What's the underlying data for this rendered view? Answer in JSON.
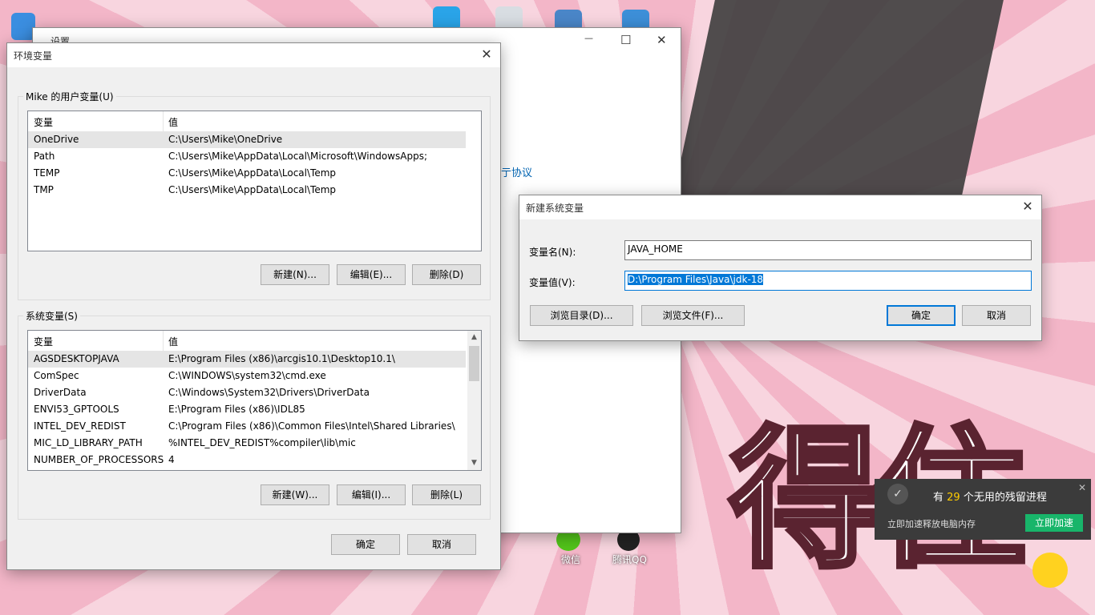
{
  "desktop": {
    "icons": [
      {
        "label": "微信"
      },
      {
        "label": "腾讯QQ"
      }
    ]
  },
  "settings_window": {
    "title": "设置",
    "link_fragment": "亍协议",
    "minimize": "—",
    "maximize": "☐",
    "close": "✕"
  },
  "env_dialog": {
    "title": "环境变量",
    "close": "✕",
    "user_group_label": "Mike 的用户变量(U)",
    "system_group_label": "系统变量(S)",
    "col_var": "变量",
    "col_value": "值",
    "user_vars": [
      {
        "name": "OneDrive",
        "value": "C:\\Users\\Mike\\OneDrive"
      },
      {
        "name": "Path",
        "value": "C:\\Users\\Mike\\AppData\\Local\\Microsoft\\WindowsApps;"
      },
      {
        "name": "TEMP",
        "value": "C:\\Users\\Mike\\AppData\\Local\\Temp"
      },
      {
        "name": "TMP",
        "value": "C:\\Users\\Mike\\AppData\\Local\\Temp"
      }
    ],
    "system_vars": [
      {
        "name": "AGSDESKTOPJAVA",
        "value": "E:\\Program Files (x86)\\arcgis10.1\\Desktop10.1\\"
      },
      {
        "name": "ComSpec",
        "value": "C:\\WINDOWS\\system32\\cmd.exe"
      },
      {
        "name": "DriverData",
        "value": "C:\\Windows\\System32\\Drivers\\DriverData"
      },
      {
        "name": "ENVI53_GPTOOLS",
        "value": "E:\\Program Files (x86)\\IDL85"
      },
      {
        "name": "INTEL_DEV_REDIST",
        "value": "C:\\Program Files (x86)\\Common Files\\Intel\\Shared Libraries\\"
      },
      {
        "name": "MIC_LD_LIBRARY_PATH",
        "value": "%INTEL_DEV_REDIST%compiler\\lib\\mic"
      },
      {
        "name": "NUMBER_OF_PROCESSORS",
        "value": "4"
      }
    ],
    "user_buttons": {
      "new": "新建(N)...",
      "edit": "编辑(E)...",
      "delete": "删除(D)"
    },
    "system_buttons": {
      "new": "新建(W)...",
      "edit": "编辑(I)...",
      "delete": "删除(L)"
    },
    "ok": "确定",
    "cancel": "取消"
  },
  "new_var_dialog": {
    "title": "新建系统变量",
    "close": "✕",
    "name_label": "变量名(N):",
    "name_value": "JAVA_HOME",
    "value_label": "变量值(V):",
    "value_value": "D:\\Program Files\\Java\\jdk-18",
    "browse_dir": "浏览目录(D)...",
    "browse_file": "浏览文件(F)...",
    "ok": "确定",
    "cancel": "取消"
  },
  "popup": {
    "prefix": "有 ",
    "count": "29",
    "suffix": " 个无用的残留进程",
    "sub": "立即加速释放电脑内存",
    "action": "立即加速",
    "close": "✕"
  },
  "colors": {
    "accent": "#0078d7",
    "link": "#0063b1",
    "popup_green": "#18b56a"
  }
}
